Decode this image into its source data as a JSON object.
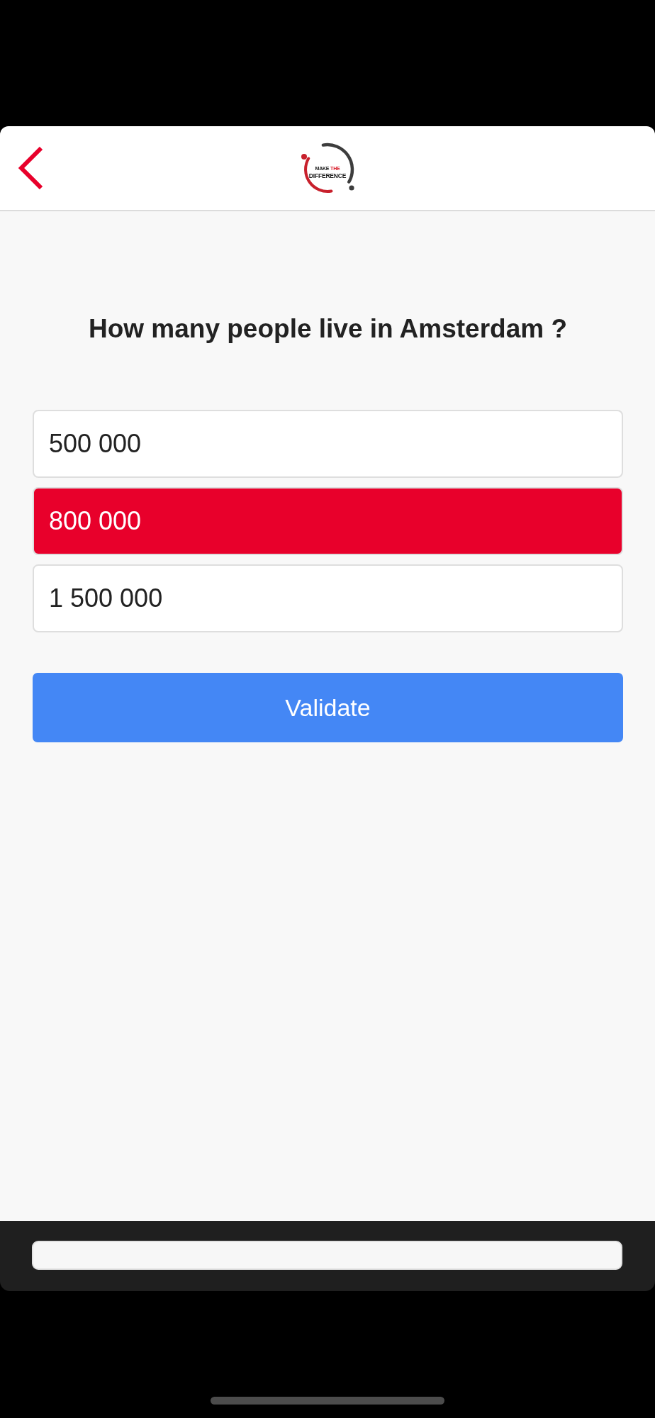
{
  "header": {
    "logo": {
      "top_line": [
        {
          "text": "MAKE",
          "accent": false
        },
        {
          "text": "THE",
          "accent": true
        }
      ],
      "bottom_line": "DIFFERENCE"
    }
  },
  "question": "How many people live in Amsterdam ?",
  "options": [
    {
      "label": "500 000",
      "selected": false
    },
    {
      "label": "800 000",
      "selected": true
    },
    {
      "label": "1 500 000",
      "selected": false
    }
  ],
  "validate_button": "Validate"
}
